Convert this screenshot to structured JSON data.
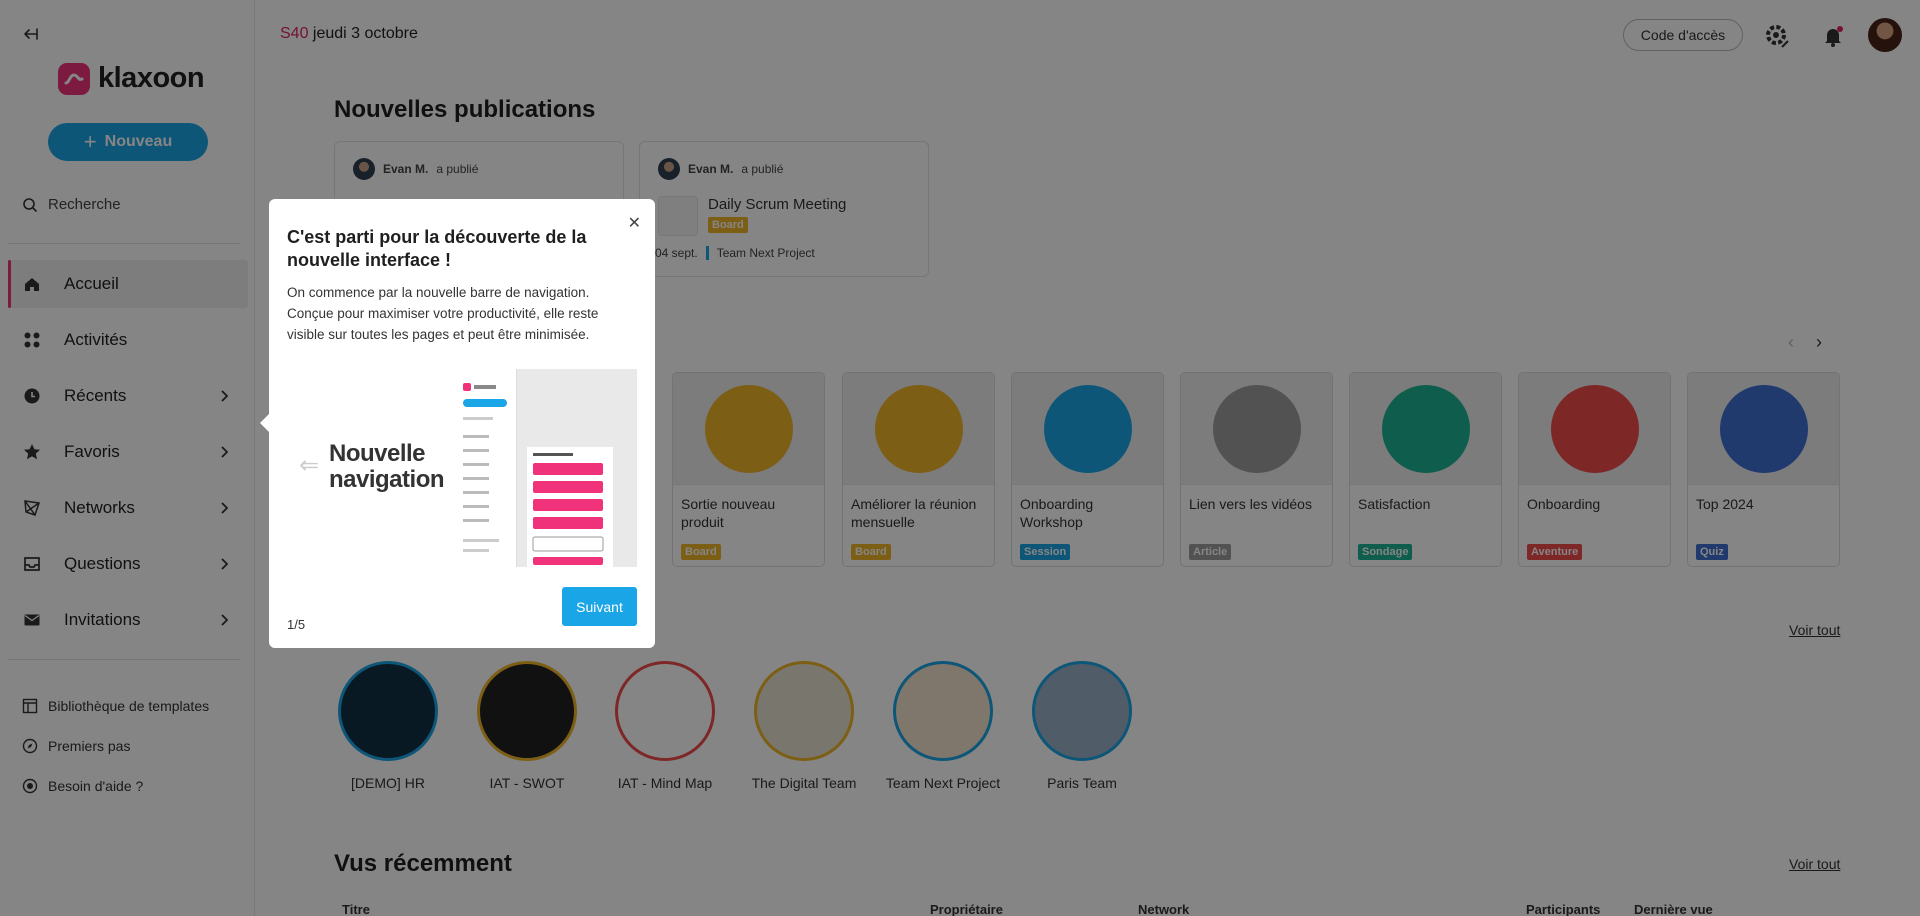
{
  "sidebar": {
    "logo_text": "klaxoon",
    "new_button": "Nouveau",
    "search_label": "Recherche",
    "nav": [
      {
        "label": "Accueil",
        "icon": "home-icon",
        "active": true,
        "chevron": false
      },
      {
        "label": "Activités",
        "icon": "grid-icon",
        "active": false,
        "chevron": false
      },
      {
        "label": "Récents",
        "icon": "clock-icon",
        "active": false,
        "chevron": true
      },
      {
        "label": "Favoris",
        "icon": "star-icon",
        "active": false,
        "chevron": true
      },
      {
        "label": "Networks",
        "icon": "network-icon",
        "active": false,
        "chevron": true
      },
      {
        "label": "Questions",
        "icon": "inbox-icon",
        "active": false,
        "chevron": true
      },
      {
        "label": "Invitations",
        "icon": "mail-icon",
        "active": false,
        "chevron": true
      }
    ],
    "footer": [
      {
        "label": "Bibliothèque de templates",
        "icon": "template-icon"
      },
      {
        "label": "Premiers pas",
        "icon": "compass-icon"
      },
      {
        "label": "Besoin d'aide ?",
        "icon": "help-icon"
      }
    ]
  },
  "header": {
    "week": "S40",
    "date": "jeudi 3 octobre",
    "code_button": "Code d'accès"
  },
  "publications": {
    "title": "Nouvelles publications",
    "items": [
      {
        "author": "Evan M.",
        "action": "a publié",
        "title": "",
        "badge": "",
        "date": "",
        "team": ""
      },
      {
        "author": "Evan M.",
        "action": "a publié",
        "title": "Daily Scrum Meeting",
        "badge": "Board",
        "date": "04 sept.",
        "team": "Team Next Project"
      }
    ]
  },
  "activities": [
    {
      "title": "Sortie nouveau produit",
      "type": "Board",
      "color": "#f0b429"
    },
    {
      "title": "Améliorer la réunion mensuelle",
      "type": "Board",
      "color": "#f0b429"
    },
    {
      "title": "Onboarding Workshop",
      "type": "Session",
      "color": "#1aa5e6"
    },
    {
      "title": "Lien vers les vidéos",
      "type": "Article",
      "color": "#9e9e9e"
    },
    {
      "title": "Satisfaction",
      "type": "Sondage",
      "color": "#1eb394"
    },
    {
      "title": "Onboarding",
      "type": "Aventure",
      "color": "#f04b4b"
    },
    {
      "title": "Top 2024",
      "type": "Quiz",
      "color": "#3f6fd4"
    }
  ],
  "networks": {
    "voir_tout": "Voir tout",
    "items": [
      {
        "name": "[DEMO] HR"
      },
      {
        "name": "IAT - SWOT"
      },
      {
        "name": "IAT - Mind Map"
      },
      {
        "name": "The Digital Team"
      },
      {
        "name": "Team Next Project"
      },
      {
        "name": "Paris Team"
      }
    ]
  },
  "recent": {
    "title": "Vus récemment",
    "voir_tout": "Voir tout",
    "columns": [
      "Titre",
      "Propriétaire",
      "Network",
      "Participants",
      "Dernière vue"
    ]
  },
  "tour": {
    "title": "C'est parti pour la découverte de la nouvelle interface !",
    "text": "On commence par la nouvelle barre de navigation. Conçue pour maximiser votre productivité, elle reste visible sur toutes les pages et peut être minimisée.",
    "illustration_text": "Nouvelle navigation",
    "step": "1/5",
    "next_button": "Suivant"
  }
}
